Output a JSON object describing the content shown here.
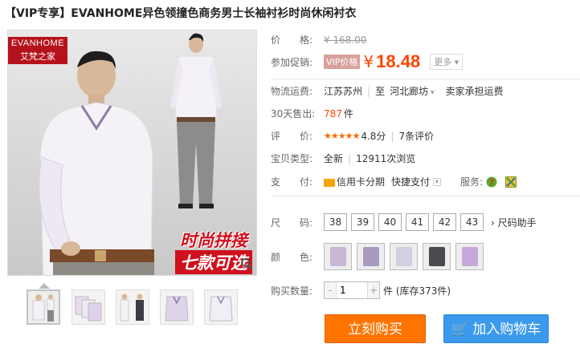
{
  "product_title": "【VIP专享】EVANHOME异色领撞色商务男士长袖衬衫时尚休闲衬衣",
  "image": {
    "logo_en": "EVANHOME",
    "logo_cn": "艾梵之家",
    "promo_line1": "时尚拼接",
    "promo_line2": "七款可选",
    "zoom_icon": "magnifier-icon"
  },
  "thumbnails": [
    {
      "name": "thumb-1",
      "active": true
    },
    {
      "name": "thumb-2",
      "active": false
    },
    {
      "name": "thumb-3",
      "active": false
    },
    {
      "name": "thumb-4",
      "active": false
    },
    {
      "name": "thumb-5",
      "active": false
    }
  ],
  "price": {
    "label": "价　　格:",
    "original": "¥ 168.00"
  },
  "promo": {
    "label": "参加促销:",
    "badge": "VIP价格",
    "currency": "¥",
    "price": "18.48",
    "more": "更多"
  },
  "shipping": {
    "label": "物流运费:",
    "from": "江苏苏州",
    "to_prefix": "至",
    "to": "河北廊坊",
    "fee": "卖家承担运费"
  },
  "sales": {
    "label": "30天售出:",
    "count": "787",
    "unit": "件"
  },
  "rating": {
    "label": "评　　价:",
    "stars": "★★★★★",
    "score": "4.8分",
    "reviews": "7条评价"
  },
  "item_type": {
    "label": "宝贝类型:",
    "condition": "全新",
    "views": "12911次浏览"
  },
  "payment": {
    "label": "支　　付:",
    "method1": "信用卡分期",
    "method2": "快捷支付",
    "service_label": "服务:"
  },
  "size": {
    "label": "尺　　码:",
    "options": [
      "38",
      "39",
      "40",
      "41",
      "42",
      "43"
    ],
    "helper": "尺码助手"
  },
  "color": {
    "label": "颜　　色:",
    "swatches": [
      "#c8b8d6",
      "#a99bbf",
      "#d4cfe0",
      "#4a4a52",
      "#c6a8da"
    ]
  },
  "quantity": {
    "label": "购买数量:",
    "value": "1",
    "stock": "件 (库存373件)"
  },
  "actions": {
    "buy_now": "立刻购买",
    "add_cart": "加入购物车"
  }
}
